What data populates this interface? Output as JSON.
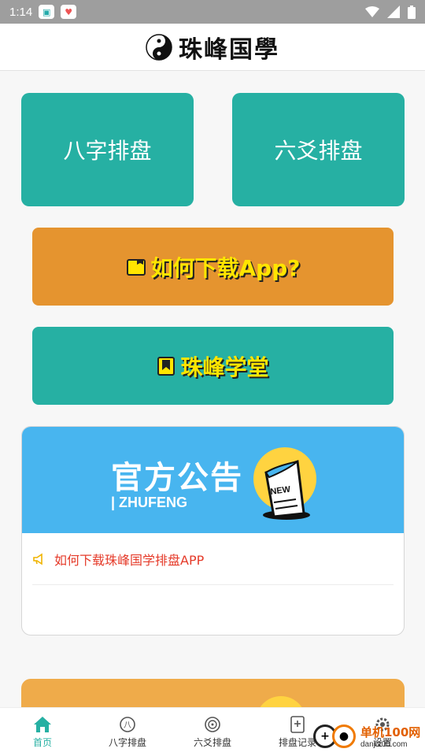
{
  "status_bar": {
    "time": "1:14"
  },
  "header": {
    "title": "珠峰国學"
  },
  "tiles": {
    "bazi": "八字排盘",
    "liuyao": "六爻排盘"
  },
  "buttons": {
    "download": "如何下载App?",
    "academy": "珠峰学堂"
  },
  "notice": {
    "banner_title": "官方公告",
    "banner_subtitle": "| ZHUFENG",
    "items": [
      {
        "text": "如何下载珠峰国学排盘APP"
      }
    ]
  },
  "tabbar": {
    "items": [
      {
        "label": "首页",
        "icon": "home-icon",
        "active": true
      },
      {
        "label": "八字排盘",
        "icon": "bazi-icon",
        "active": false
      },
      {
        "label": "六爻排盘",
        "icon": "liuyao-icon",
        "active": false
      },
      {
        "label": "排盘记录",
        "icon": "record-icon",
        "active": false
      },
      {
        "label": "设置",
        "icon": "settings-icon",
        "active": false
      }
    ]
  },
  "watermark": {
    "line1": "单机100网",
    "line2": "danji100.com"
  },
  "colors": {
    "teal": "#26b0a3",
    "orange": "#e5942f",
    "yellow_text": "#ffe500",
    "banner_blue": "#48b5ef",
    "notice_red": "#e53b2a"
  }
}
